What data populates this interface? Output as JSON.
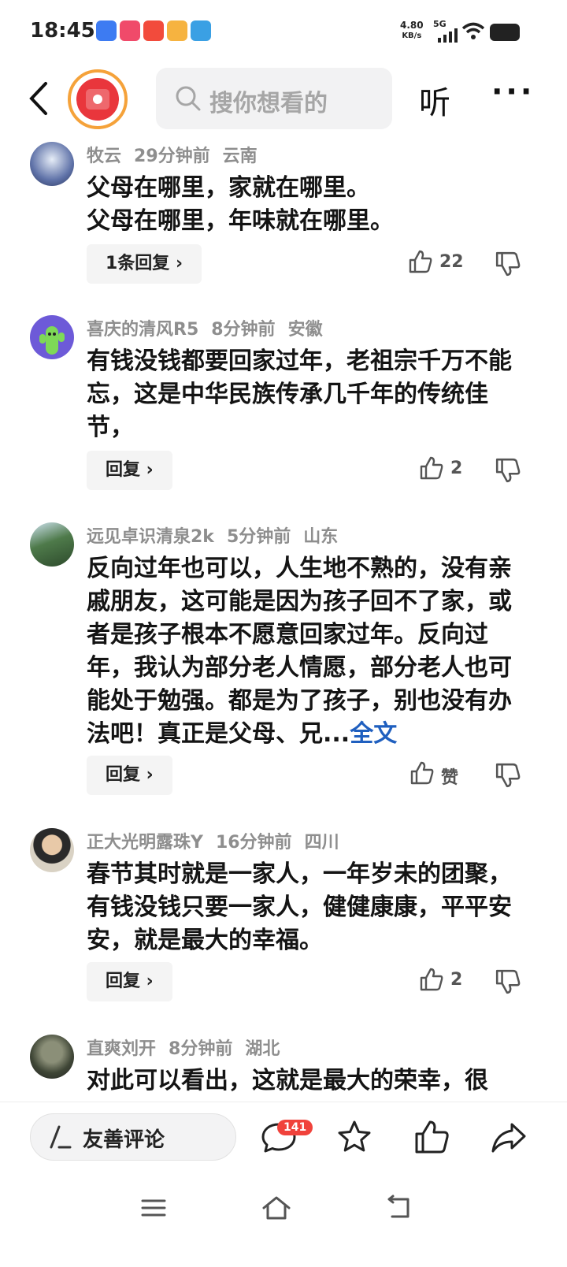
{
  "status_bar": {
    "time": "18:45",
    "net_speed_value": "4.80",
    "net_speed_unit": "KB/s",
    "network": "5G",
    "notification_icons": [
      "browser-icon",
      "app-icon-pink",
      "toutiao-icon",
      "weather-icon",
      "telegram-icon"
    ]
  },
  "header": {
    "search_placeholder": "搜你想看的",
    "listen_label": "听",
    "more_label": "···"
  },
  "comments": [
    {
      "user": "牧云",
      "time": "29分钟前",
      "location": "云南",
      "text": "父母在哪里，家就在哪里。\n父母在哪里，年味就在哪里。",
      "reply_label": "1条回复 ›",
      "likes": "22"
    },
    {
      "user": "喜庆的清风R5",
      "time": "8分钟前",
      "location": "安徽",
      "text": "有钱没钱都要回家过年，老祖宗千万不能忘，这是中华民族传承几千年的传统佳节，",
      "reply_label": "回复 ›",
      "likes": "2"
    },
    {
      "user": "远见卓识清泉2k",
      "time": "5分钟前",
      "location": "山东",
      "text": "反向过年也可以，人生地不熟的，没有亲戚朋友，这可能是因为孩子回不了家，或者是孩子根本不愿意回家过年。反向过年，我认为部分老人情愿，部分老人也可能处于勉强。都是为了孩子，别也没有办法吧！真正是父母、兄...",
      "fulltext_label": "全文",
      "reply_label": "回复 ›",
      "likes": "赞"
    },
    {
      "user": "正大光明露珠Y",
      "time": "16分钟前",
      "location": "四川",
      "text": "春节其时就是一家人，一年岁未的团聚，有钱没钱只要一家人，健健康康，平平安安，就是最大的幸福。",
      "reply_label": "回复 ›",
      "likes": "2"
    },
    {
      "user": "直爽刘开",
      "time": "8分钟前",
      "location": "湖北",
      "text": "对此可以看出，这就是最大的荣幸，很"
    }
  ],
  "bottom_bar": {
    "compose_label": "友善评论",
    "comment_count": "141"
  },
  "colors": {
    "accent_link": "#1f5fbf",
    "badge": "#f0423b",
    "app_avatar_ring": "#f5a23a"
  }
}
